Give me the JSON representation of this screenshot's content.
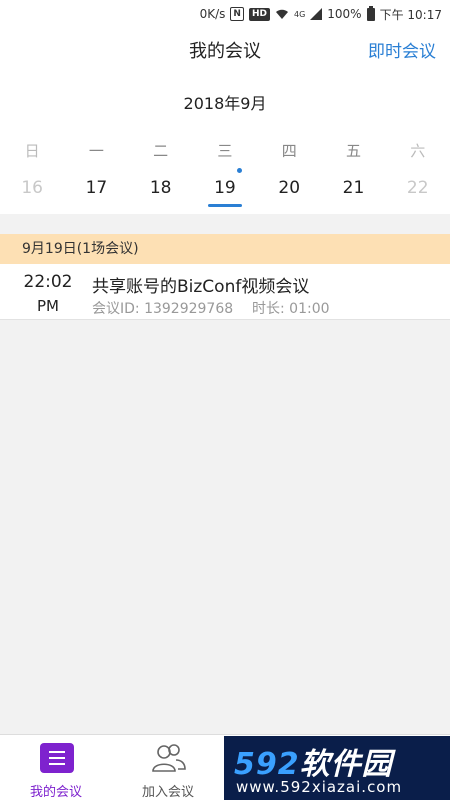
{
  "status_bar": {
    "speed": "0K/s",
    "nfc": "N",
    "hd": "HD",
    "network": "4G",
    "battery": "100%",
    "time": "下午 10:17"
  },
  "header": {
    "title": "我的会议",
    "instant_meeting": "即时会议"
  },
  "calendar": {
    "month_label": "2018年9月",
    "weekdays": [
      "日",
      "一",
      "二",
      "三",
      "四",
      "五",
      "六"
    ],
    "dates": [
      "16",
      "17",
      "18",
      "19",
      "20",
      "21",
      "22"
    ],
    "selected_date": "19",
    "accent_color": "#2a7fd4"
  },
  "meetings_section": {
    "header": "9月19日(1场会议)",
    "items": [
      {
        "time": "22:02",
        "ampm": "PM",
        "title": "共享账号的BizConf视频会议",
        "meeting_id": "会议ID: 1392929768",
        "duration": "时长: 01:00"
      }
    ]
  },
  "bottom_nav": {
    "tabs": [
      {
        "label": "我的会议",
        "icon": "list-icon",
        "active": true
      },
      {
        "label": "加入会议",
        "icon": "people-icon",
        "active": false
      }
    ],
    "active_color": "#7e22ce"
  },
  "watermark": {
    "num": "592",
    "text": "软件园",
    "url": "www.592xiazai.com"
  }
}
